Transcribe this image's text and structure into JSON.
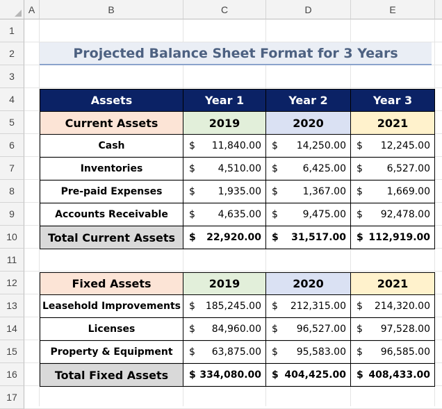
{
  "columns": [
    "A",
    "B",
    "C",
    "D",
    "E"
  ],
  "rows": [
    "1",
    "2",
    "3",
    "4",
    "5",
    "6",
    "7",
    "8",
    "9",
    "10",
    "11",
    "12",
    "13",
    "14",
    "15",
    "16",
    "17"
  ],
  "title": "Projected Balance Sheet Format for 3 Years",
  "table1": {
    "header": [
      "Assets",
      "Year 1",
      "Year 2",
      "Year 3"
    ],
    "section": [
      "Current Assets",
      "2019",
      "2020",
      "2021"
    ],
    "rows": [
      {
        "label": "Cash",
        "values": [
          [
            "$",
            "11,840.00"
          ],
          [
            "$",
            "14,250.00"
          ],
          [
            "$",
            "12,245.00"
          ]
        ]
      },
      {
        "label": "Inventories",
        "values": [
          [
            "$",
            "4,510.00"
          ],
          [
            "$",
            "6,425.00"
          ],
          [
            "$",
            "6,527.00"
          ]
        ]
      },
      {
        "label": "Pre-paid Expenses",
        "values": [
          [
            "$",
            "1,935.00"
          ],
          [
            "$",
            "1,367.00"
          ],
          [
            "$",
            "1,669.00"
          ]
        ]
      },
      {
        "label": "Accounts Receivable",
        "values": [
          [
            "$",
            "4,635.00"
          ],
          [
            "$",
            "9,475.00"
          ],
          [
            "$",
            "92,478.00"
          ]
        ]
      }
    ],
    "total": {
      "label": "Total Current Assets",
      "values": [
        [
          "$",
          "22,920.00"
        ],
        [
          "$",
          "31,517.00"
        ],
        [
          "$",
          "112,919.00"
        ]
      ]
    }
  },
  "table2": {
    "section": [
      "Fixed Assets",
      "2019",
      "2020",
      "2021"
    ],
    "rows": [
      {
        "label": "Leasehold Improvements",
        "values": [
          [
            "$",
            "185,245.00"
          ],
          [
            "$",
            "212,315.00"
          ],
          [
            "$",
            "214,320.00"
          ]
        ]
      },
      {
        "label": "Licenses",
        "values": [
          [
            "$",
            "84,960.00"
          ],
          [
            "$",
            "96,527.00"
          ],
          [
            "$",
            "97,528.00"
          ]
        ]
      },
      {
        "label": "Property & Equipment",
        "values": [
          [
            "$",
            "63,875.00"
          ],
          [
            "$",
            "95,583.00"
          ],
          [
            "$",
            "96,585.00"
          ]
        ]
      }
    ],
    "total": {
      "label": "Total Fixed Assets",
      "values": [
        [
          "$",
          "334,080.00"
        ],
        [
          "$",
          "404,425.00"
        ],
        [
          "$",
          "408,433.00"
        ]
      ]
    }
  },
  "colors": {
    "header_bg": "#0b2265",
    "peach": "#fce4d6",
    "green": "#e2efda",
    "blue": "#dae1f3",
    "yellow": "#fff2cc",
    "total_bg": "#d9d9d9",
    "title_text": "#4d6181"
  }
}
